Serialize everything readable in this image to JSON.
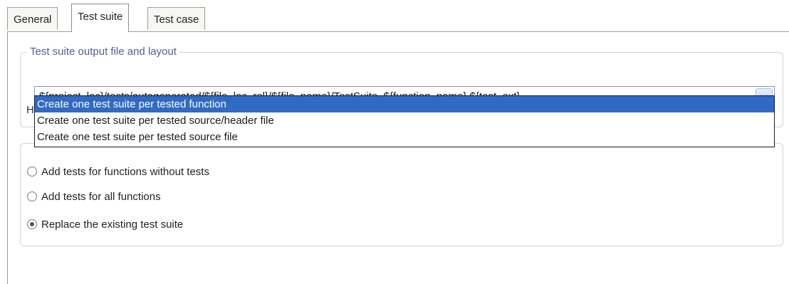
{
  "tabs": [
    {
      "label": "General",
      "active": false
    },
    {
      "label": "Test suite",
      "active": true
    },
    {
      "label": "Test case",
      "active": false
    }
  ],
  "output_group": {
    "legend": "Test suite output file and layout",
    "combo_value": "${project_loc}/tests/autogenerated/${file_loc_rel}/${file_name}/TestSuite_${function_name}.${test_ext}",
    "combo_icon": "chevron-down-icon",
    "dropdown_options": [
      {
        "label": "Create one test suite per tested function",
        "selected": true
      },
      {
        "label": "Create one test suite per tested source/header file",
        "selected": false
      },
      {
        "label": "Create one test suite per tested source file",
        "selected": false
      }
    ],
    "partially_hidden_label_start": "H"
  },
  "existing_group": {
    "options": [
      {
        "label": "Add tests for functions without tests",
        "checked": false
      },
      {
        "label": "Add tests for all functions",
        "checked": false
      },
      {
        "label": "Replace the existing test suite",
        "checked": true
      }
    ]
  },
  "colors": {
    "selection": "#316ac5",
    "legend": "#4b5f9e",
    "combo_border": "#7f9db9"
  }
}
